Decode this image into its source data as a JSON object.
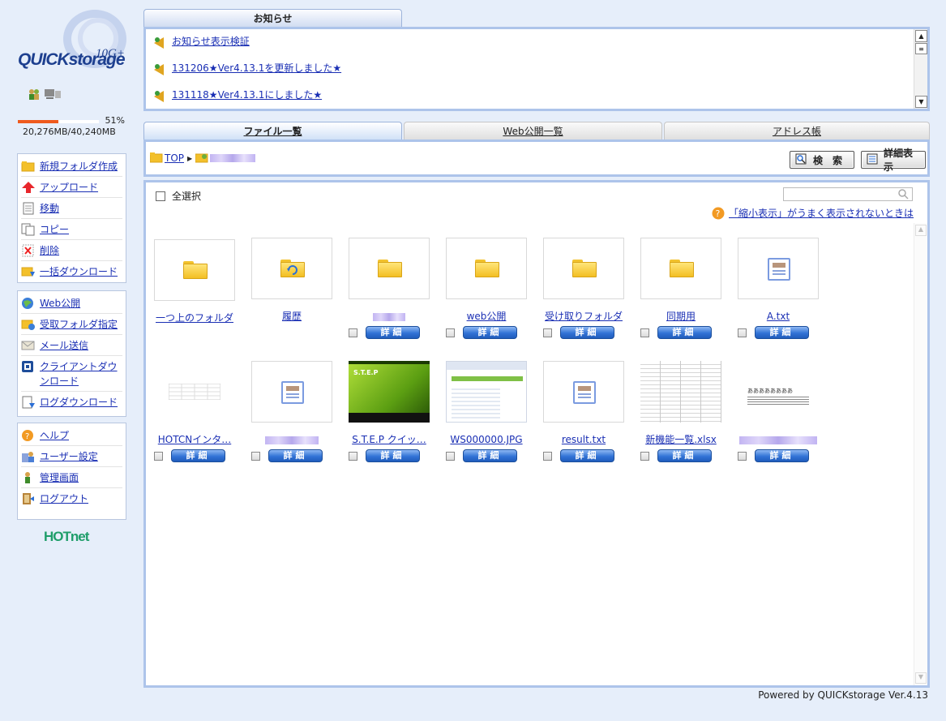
{
  "sidebar": {
    "logo": {
      "brand": "QUICKstorage",
      "version": "10G+"
    },
    "usage": {
      "percent_label": "51%",
      "percent_value": 0.5,
      "size": "20,276MB/40,240MB"
    },
    "menu1": [
      {
        "label": "新規フォルダ作成",
        "icon": "new-folder-icon"
      },
      {
        "label": "アップロード",
        "icon": "upload-icon"
      },
      {
        "label": "移動",
        "icon": "move-icon"
      },
      {
        "label": "コピー",
        "icon": "copy-icon"
      },
      {
        "label": "削除",
        "icon": "delete-icon"
      },
      {
        "label": "一括ダウンロード",
        "icon": "bulk-download-icon"
      }
    ],
    "menu2": [
      {
        "label": "Web公開",
        "icon": "globe-icon"
      },
      {
        "label": "受取フォルダ指定",
        "icon": "receive-folder-icon"
      },
      {
        "label": "メール送信",
        "icon": "mail-icon"
      },
      {
        "label": "クライアントダウンロード",
        "icon": "client-download-icon"
      },
      {
        "label": "ログダウンロード",
        "icon": "log-download-icon"
      }
    ],
    "menu3": [
      {
        "label": "ヘルプ",
        "icon": "help-icon"
      },
      {
        "label": "ユーザー設定",
        "icon": "user-settings-icon"
      },
      {
        "label": "管理画面",
        "icon": "admin-icon"
      },
      {
        "label": "ログアウト",
        "icon": "logout-icon"
      }
    ],
    "footer_logo": "HOTnet"
  },
  "notice": {
    "tab_label": "お知らせ",
    "items": [
      "お知らせ表示検証",
      "131206★Ver4.13.1を更新しました★",
      "131118★Ver4.13.1にしました★"
    ]
  },
  "tabs": {
    "files": "ファイル一覧",
    "web": "Web公開一覧",
    "address": "アドレス帳"
  },
  "toolbar": {
    "breadcrumb_root": "TOP",
    "search_label": "検　索",
    "detail_view_label": "詳細表示"
  },
  "content": {
    "select_all_label": "全選択",
    "search_placeholder": "",
    "thumb_help": "「縮小表示」がうまく表示されないときは",
    "detail_button": "詳細",
    "row1": [
      {
        "name": "一つ上のフォルダ",
        "kind": "folder",
        "checkbox": false
      },
      {
        "name": "履歴",
        "kind": "history-folder",
        "checkbox": false
      },
      {
        "name": "",
        "kind": "folder",
        "checkbox": true,
        "blurred": true
      },
      {
        "name": "web公開",
        "kind": "folder",
        "checkbox": true
      },
      {
        "name": "受け取りフォルダ",
        "kind": "folder",
        "checkbox": true
      },
      {
        "name": "同期用",
        "kind": "folder",
        "checkbox": true
      },
      {
        "name": "A.txt",
        "kind": "doc",
        "checkbox": true
      }
    ],
    "row2": [
      {
        "name": "HOTCNインタ…",
        "kind": "table-preview",
        "checkbox": true
      },
      {
        "name": "",
        "kind": "doc",
        "checkbox": true,
        "blurred": true
      },
      {
        "name": "S.T.E.P クイッ…",
        "kind": "step-preview",
        "checkbox": true,
        "preview_title": "S.T.E.P"
      },
      {
        "name": "WS000000.JPG",
        "kind": "screenshot-preview",
        "checkbox": true
      },
      {
        "name": "result.txt",
        "kind": "doc",
        "checkbox": true
      },
      {
        "name": "新機能一覧.xlsx",
        "kind": "sheet-preview",
        "checkbox": true
      },
      {
        "name": "",
        "kind": "text-preview",
        "checkbox": true,
        "blurred": true,
        "preview_text": "ああああああああ"
      }
    ]
  },
  "footer": {
    "powered": "Powered by QUICKstorage Ver.4.13"
  }
}
